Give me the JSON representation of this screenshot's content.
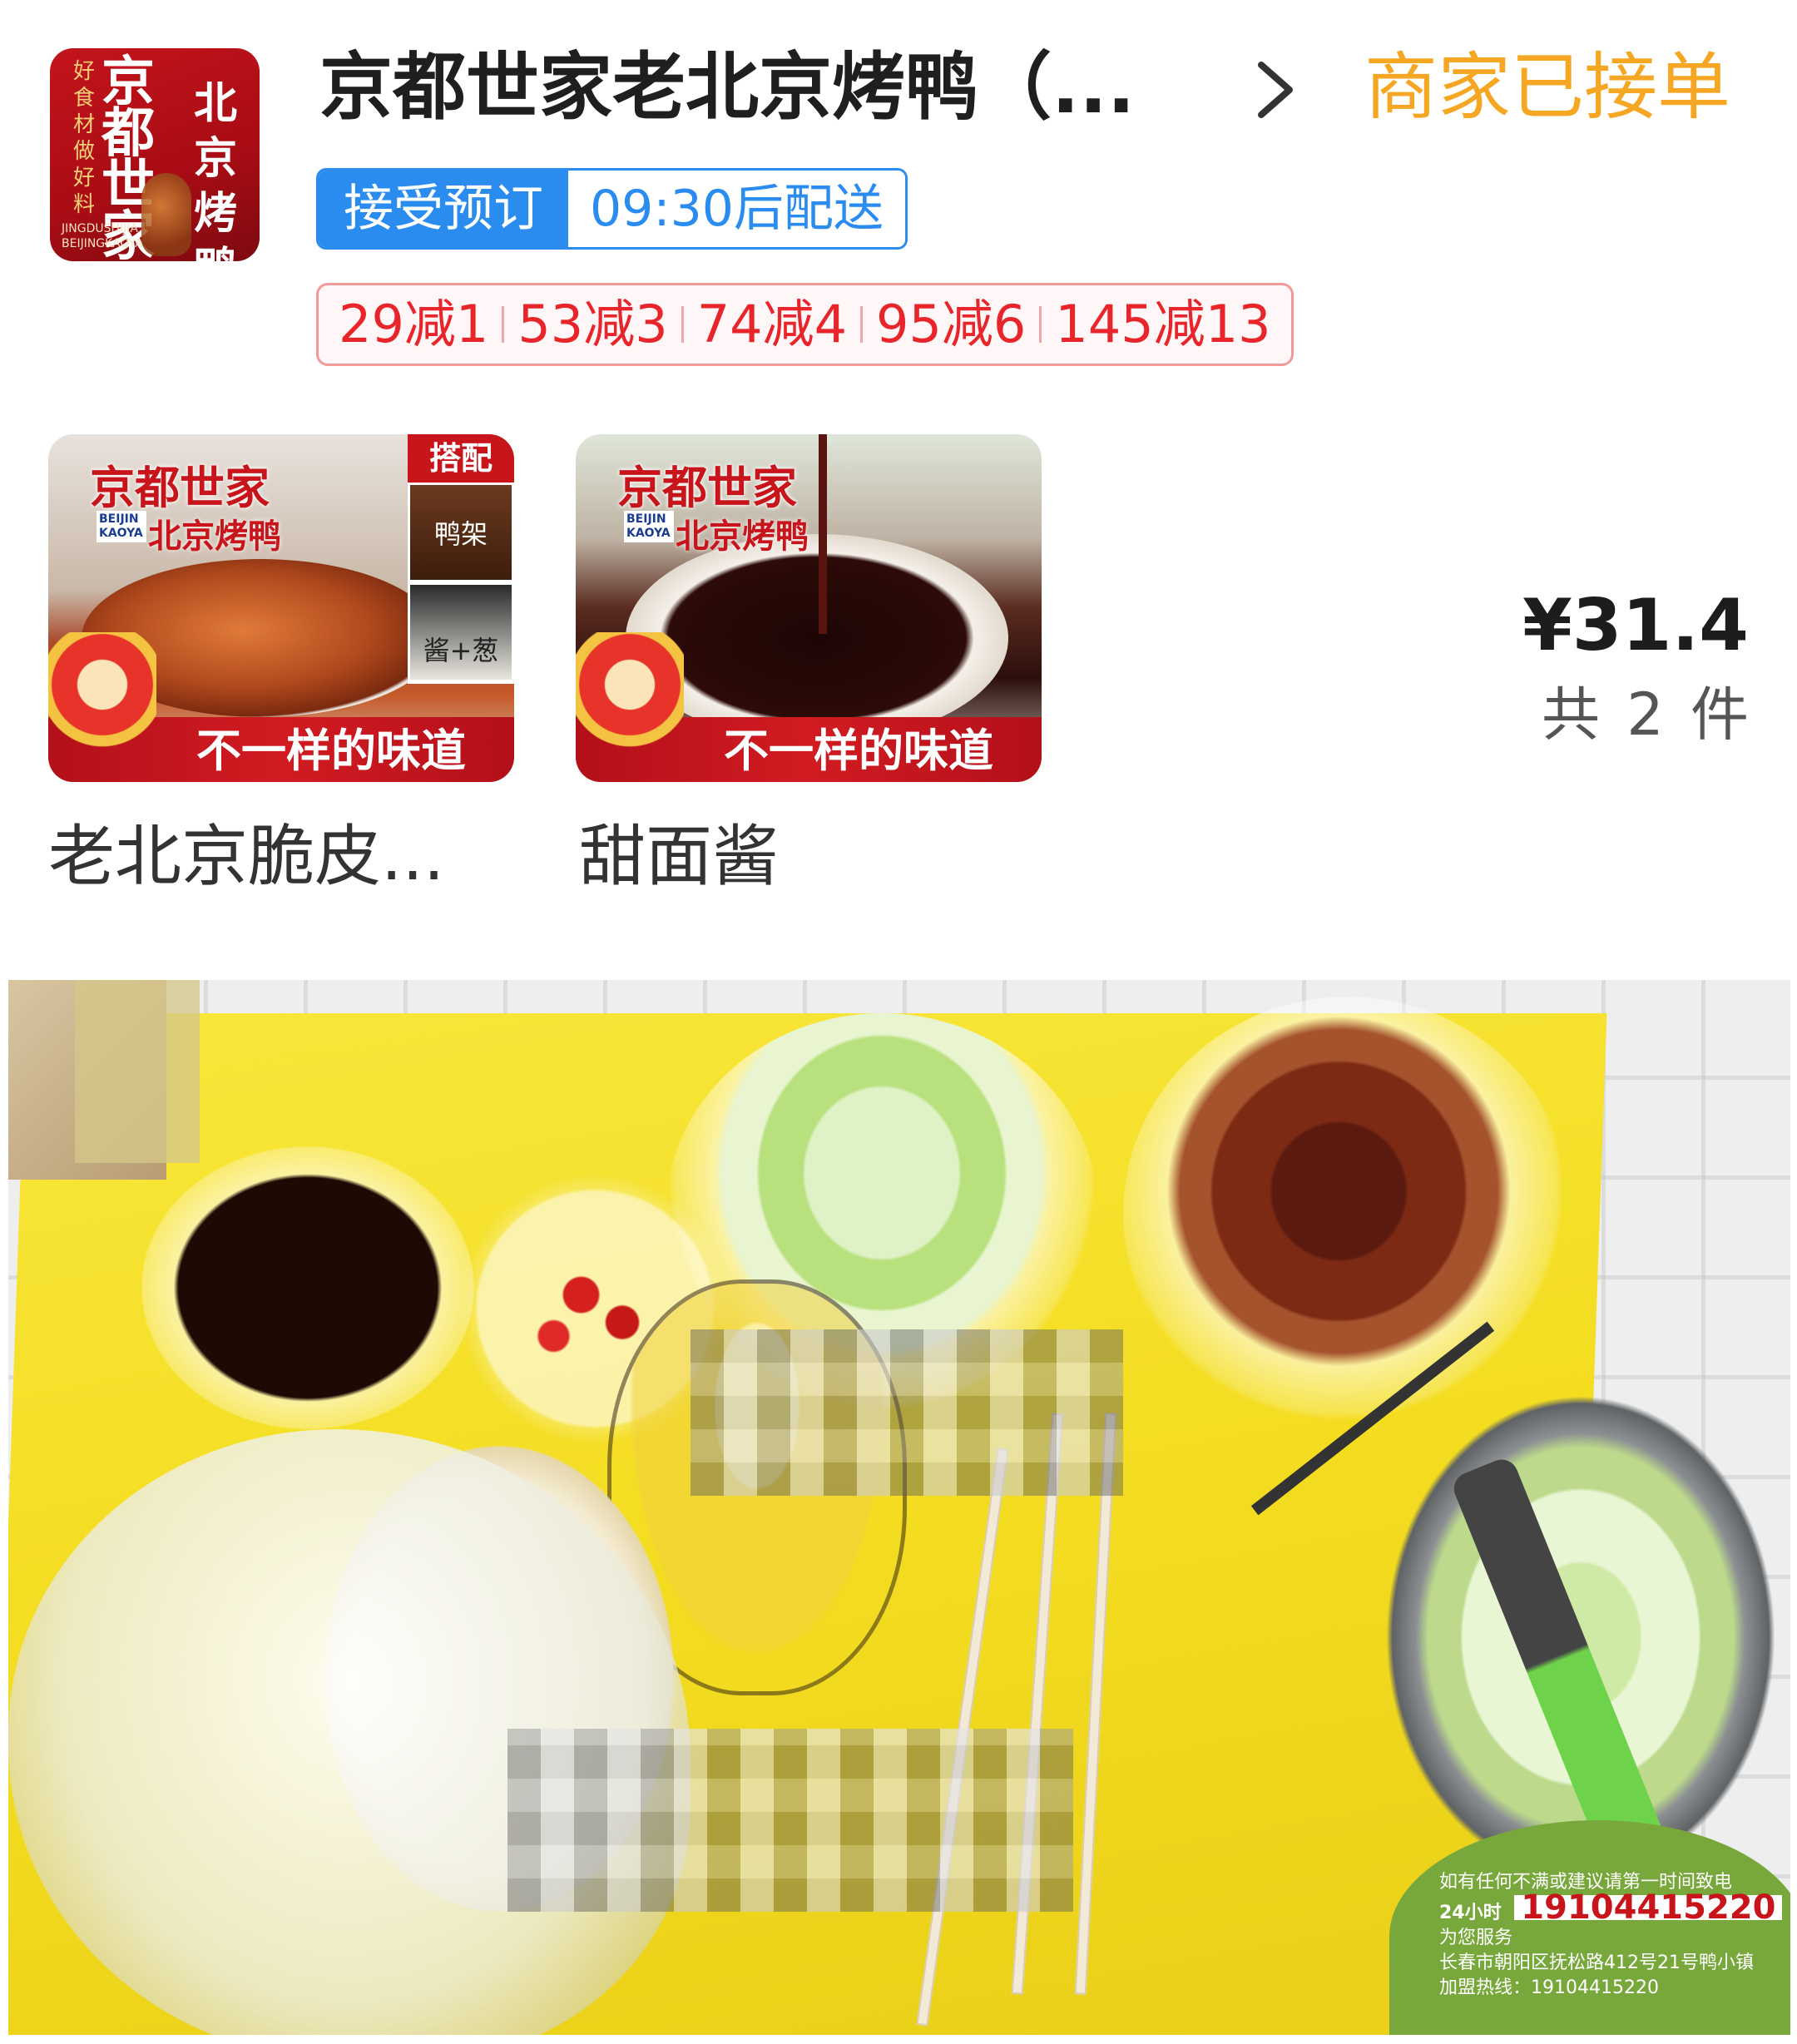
{
  "store": {
    "logo": {
      "left_text": [
        "京",
        "都",
        "世",
        "家"
      ],
      "right_text": [
        "北",
        "京",
        "烤",
        "鸭"
      ],
      "slogan": [
        "好",
        "食",
        "材",
        "做",
        "好",
        "料"
      ],
      "en_lines": [
        "JINGDUSHIJIA",
        "BEIJINGKAOYA"
      ]
    },
    "name": "京都世家老北京烤鸭（...",
    "order_status": "商家已接单",
    "preorder_label": "接受预订",
    "delivery_time": "09:30后配送",
    "discounts": [
      "29减1",
      "53减3",
      "74减4",
      "95减6",
      "145减13"
    ]
  },
  "products": [
    {
      "name": "老北京脆皮...",
      "image": {
        "brand": "京都世家",
        "brand_sub": "北京烤鸭",
        "brand_en": [
          "BEIJIN",
          "KAOYA"
        ],
        "banner": "不一样的味道",
        "combo_title": "搭配",
        "combo_items": [
          "鸭架",
          "酱+葱"
        ]
      }
    },
    {
      "name": "甜面酱",
      "image": {
        "brand": "京都世家",
        "brand_sub": "北京烤鸭",
        "brand_en": [
          "BEIJIN",
          "KAOYA"
        ],
        "banner": "不一样的味道"
      }
    }
  ],
  "summary": {
    "price": "¥31.4",
    "count": "共 2 件"
  },
  "photo": {
    "card_text": "如有任何不满或建议请第一时间致电",
    "card_hours": "24小时",
    "card_service": "为您服务",
    "card_phone": "19104415220",
    "card_address": "长春市朝阳区抚松路412号21号鸭小镇",
    "card_hotline": "加盟热线：19104415220"
  },
  "colors": {
    "order_status": "#f5a623",
    "preorder": "#2b8cf0",
    "discount": "#e8252b",
    "brand_red": "#c8141b"
  }
}
